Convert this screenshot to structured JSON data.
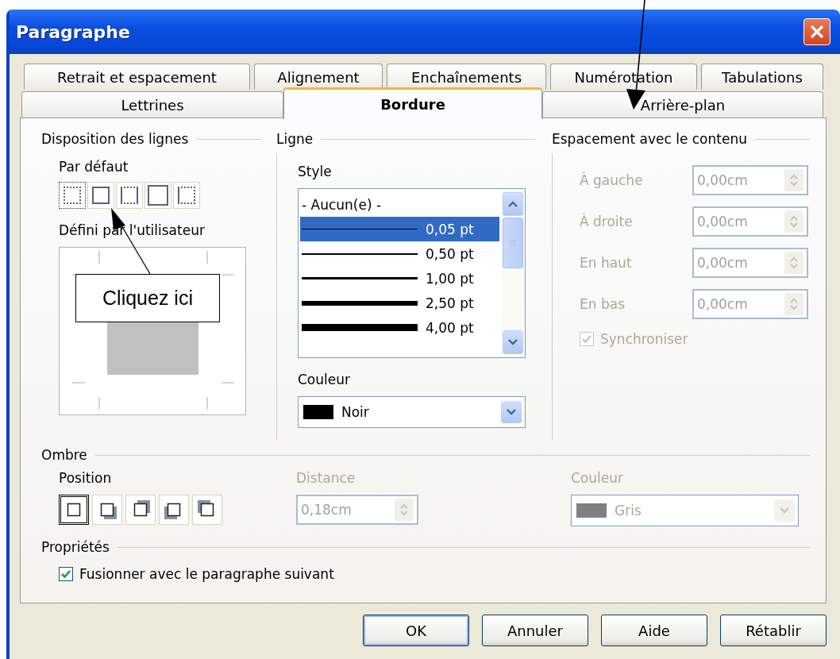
{
  "window": {
    "title": "Paragraphe"
  },
  "tab_rows": [
    {
      "tabs": [
        {
          "label": "Retrait et espacement",
          "selected": false
        },
        {
          "label": "Alignement",
          "selected": false
        },
        {
          "label": "Enchaînements",
          "selected": false
        },
        {
          "label": "Numérotation",
          "selected": false
        },
        {
          "label": "Tabulations",
          "selected": false
        }
      ]
    },
    {
      "tabs": [
        {
          "label": "Lettrines",
          "selected": false
        },
        {
          "label": "Bordure",
          "selected": true
        },
        {
          "label": "Arrière-plan",
          "selected": false
        }
      ]
    }
  ],
  "line_arrangement": {
    "heading": "Disposition des lignes",
    "default_label": "Par défaut",
    "presets": [
      {
        "kind": "none"
      },
      {
        "kind": "all"
      },
      {
        "kind": "sides"
      },
      {
        "kind": "outer"
      },
      {
        "kind": "left"
      }
    ],
    "user_defined_label": "Défini par l'utilisateur"
  },
  "line": {
    "heading": "Ligne",
    "style_label": "Style",
    "styles": [
      {
        "kind": "none",
        "label": "- Aucun(e) -",
        "selected": false
      },
      {
        "kind": "line",
        "label": "0,05 pt",
        "selected": true
      },
      {
        "kind": "line",
        "label": "0,50 pt",
        "selected": false
      },
      {
        "kind": "line",
        "label": "1,00 pt",
        "selected": false
      },
      {
        "kind": "line",
        "label": "2,50 pt",
        "selected": false
      },
      {
        "kind": "line",
        "label": "4,00 pt",
        "selected": false
      }
    ],
    "color_label": "Couleur",
    "color_value": "Noir"
  },
  "spacing": {
    "heading": "Espacement avec le contenu",
    "rows": [
      {
        "label": "À gauche",
        "value": "0,00cm",
        "disabled": true
      },
      {
        "label": "À droite",
        "value": "0,00cm",
        "disabled": true
      },
      {
        "label": "En haut",
        "value": "0,00cm",
        "disabled": true
      },
      {
        "label": "En bas",
        "value": "0,00cm",
        "disabled": true
      }
    ],
    "synchronize": {
      "label": "Synchroniser",
      "checked": true,
      "disabled": true
    }
  },
  "shadow": {
    "heading": "Ombre",
    "position_label": "Position",
    "positions": [
      {
        "kind": "none",
        "selected": true
      },
      {
        "kind": "bottom-right",
        "selected": false
      },
      {
        "kind": "top-right",
        "selected": false
      },
      {
        "kind": "bottom-left",
        "selected": false
      },
      {
        "kind": "top-left",
        "selected": false
      }
    ],
    "distance": {
      "label": "Distance",
      "value": "0,18cm",
      "disabled": true
    },
    "color": {
      "label": "Couleur",
      "value": "Gris",
      "disabled": true
    }
  },
  "properties": {
    "heading": "Propriétés",
    "merge": {
      "label": "Fusionner avec le paragraphe suivant",
      "checked": true
    }
  },
  "buttons": [
    {
      "label": "OK",
      "default": true
    },
    {
      "label": "Annuler",
      "default": false
    },
    {
      "label": "Aide",
      "default": false
    },
    {
      "label": "Rétablir",
      "default": false
    }
  ],
  "callout": {
    "text": "Cliquez ici"
  }
}
